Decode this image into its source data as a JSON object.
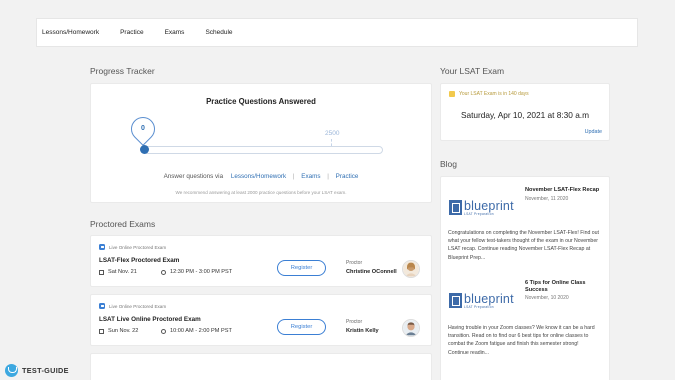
{
  "nav": {
    "items": [
      {
        "label": "Lessons/Homework"
      },
      {
        "label": "Practice"
      },
      {
        "label": "Exams"
      },
      {
        "label": "Schedule"
      }
    ]
  },
  "progress": {
    "section_title": "Progress Tracker",
    "heading": "Practice Questions Answered",
    "current_value": "0",
    "goal_value": "2500",
    "answer_prefix": "Answer questions via",
    "links": [
      "Lessons/Homework",
      "Exams",
      "Practice"
    ],
    "separator": "|",
    "recommendation": "We recommend answering at least 2000 practice questions before your LSAT exam."
  },
  "proctored": {
    "section_title": "Proctored Exams",
    "exams": [
      {
        "type": "Live Online Proctored Exam",
        "name": "LSAT-Flex Proctored Exam",
        "date": "Sat Nov. 21",
        "time": "12:30 PM - 3:00 PM PST",
        "register_label": "Register",
        "proctor_label": "Proctor",
        "proctor_name": "Christine OConnell"
      },
      {
        "type": "Live Online Proctored Exam",
        "name": "LSAT Live Online Proctored Exam",
        "date": "Sun Nov. 22",
        "time": "10:00 AM - 2:00 PM PST",
        "register_label": "Register",
        "proctor_label": "Proctor",
        "proctor_name": "Kristin Kelly"
      }
    ]
  },
  "lsat": {
    "section_title": "Your LSAT Exam",
    "note": "Your LSAT Exam is in 140 days",
    "date": "Saturday, Apr 10, 2021 at 8:30 a.m",
    "update_label": "Update"
  },
  "blog": {
    "section_title": "Blog",
    "logo_word": "blueprint",
    "logo_sub": "LSAT Preparation",
    "posts": [
      {
        "title": "November LSAT-Flex Recap",
        "date": "November, 11 2020",
        "excerpt": "Congratulations on completing the November LSAT-Flex! Find out what your fellow test-takers thought of the exam in our November LSAT recap. Continue reading November LSAT-Flex Recap at Blueprint Prep..."
      },
      {
        "title": "6 Tips for Online Class Success",
        "date": "November, 10 2020",
        "excerpt": "Having trouble in your Zoom classes? We know it can be a hard transition. Read on to find our 6 best tips for online classes to combat the Zoom fatigue and finish this semester strong! Continue readin..."
      }
    ]
  },
  "footer": {
    "brand": "TEST-GUIDE"
  },
  "colors": {
    "accent": "#2f6fb3",
    "brand_blue": "#3d6aa8",
    "warning": "#f2c94c"
  }
}
